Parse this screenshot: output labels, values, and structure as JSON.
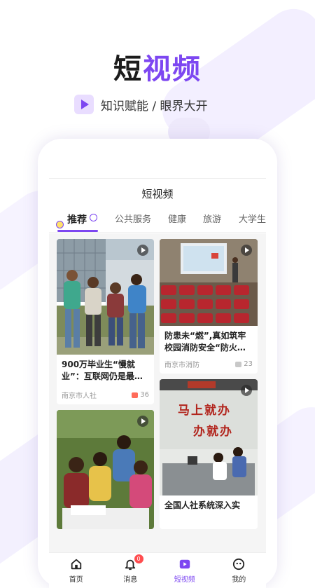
{
  "hero": {
    "title_black": "短",
    "title_purple": "视频",
    "tagline": "知识赋能 / 眼界大开"
  },
  "app": {
    "header_title": "短视频",
    "tabs": [
      {
        "label": "推荐",
        "active": true
      },
      {
        "label": "公共服务",
        "active": false
      },
      {
        "label": "健康",
        "active": false
      },
      {
        "label": "旅游",
        "active": false
      },
      {
        "label": "大学生",
        "active": false
      }
    ]
  },
  "feed": {
    "cards": [
      {
        "title": "900万毕业生“慢就业”：互联网仍是最…",
        "source": "南京市人社",
        "likes": "36",
        "liked": true
      },
      {
        "title": "防患未“燃”,真如筑牢校园消防安全“防火…",
        "source": "南京市消防",
        "likes": "23",
        "liked": false
      },
      {
        "title": "",
        "source": "",
        "likes": "",
        "liked": false
      },
      {
        "title": "全国人社系统深入实",
        "source": "",
        "likes": "",
        "liked": false
      }
    ],
    "signboard_text_1": "马上就办",
    "signboard_text_2": "办就办"
  },
  "bottom_nav": {
    "items": [
      {
        "label": "首页",
        "icon": "home-icon"
      },
      {
        "label": "消息",
        "icon": "bell-icon",
        "badge": "0"
      },
      {
        "label": "短视频",
        "icon": "video-icon",
        "active": true
      },
      {
        "label": "我的",
        "icon": "face-icon"
      }
    ]
  },
  "colors": {
    "accent": "#7d47f1",
    "badge": "#ff4d4f",
    "like": "#ff6b5a"
  }
}
